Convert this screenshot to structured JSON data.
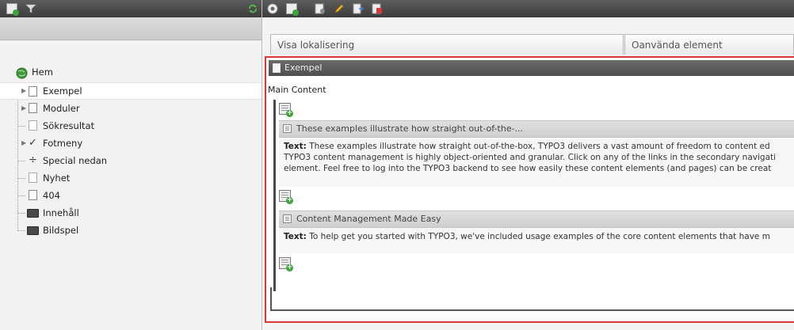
{
  "left_toolbar": {
    "icons": [
      "new-page-icon",
      "filter-icon",
      "refresh-icon"
    ]
  },
  "right_toolbar": {
    "icons": [
      "view-icon",
      "new-record-icon",
      "page-properties-icon",
      "edit-icon",
      "move-icon",
      "history-icon"
    ]
  },
  "tree": {
    "root_label": "Hem",
    "items": [
      {
        "label": "Exempel",
        "icon": "page-icon",
        "expandable": true,
        "selected": true
      },
      {
        "label": "Moduler",
        "icon": "page-icon",
        "expandable": true
      },
      {
        "label": "Sökresultat",
        "icon": "page-icon"
      },
      {
        "label": "Fotmeny",
        "icon": "checkmark-icon",
        "expandable": true
      },
      {
        "label": "Special nedan",
        "icon": "divider-icon"
      },
      {
        "label": "Nyhet",
        "icon": "page-icon"
      },
      {
        "label": "404",
        "icon": "page-icon"
      },
      {
        "label": "Innehåll",
        "icon": "folder-icon"
      },
      {
        "label": "Bildspel",
        "icon": "folder-icon"
      }
    ]
  },
  "tabs": [
    {
      "label": "Visa lokalisering"
    },
    {
      "label": "Oanvända element"
    }
  ],
  "page": {
    "title": "Exempel",
    "column_label": "Main Content",
    "content_elements": [
      {
        "header": "These examples illustrate how straight out-of-the-...",
        "text_label": "Text:",
        "text_lines": [
          " These examples illustrate how straight out-of-the-box, TYPO3 delivers a vast amount of freedom to content ed",
          "TYPO3 content management is highly object-oriented and granular. Click on any of the links in the secondary navigati",
          "element. Feel free to log into the TYPO3 backend to see how easily these content elements (and pages) can be creat"
        ]
      },
      {
        "header": "Content Management Made Easy",
        "text_label": "Text:",
        "text_lines": [
          " To help get you started with TYPO3, we've included usage examples of the core content elements that have m"
        ]
      }
    ]
  },
  "colors": {
    "selection_frame": "#d9383a",
    "toolbar": "#4a4a4a",
    "new_badge": "#3fa43a"
  }
}
